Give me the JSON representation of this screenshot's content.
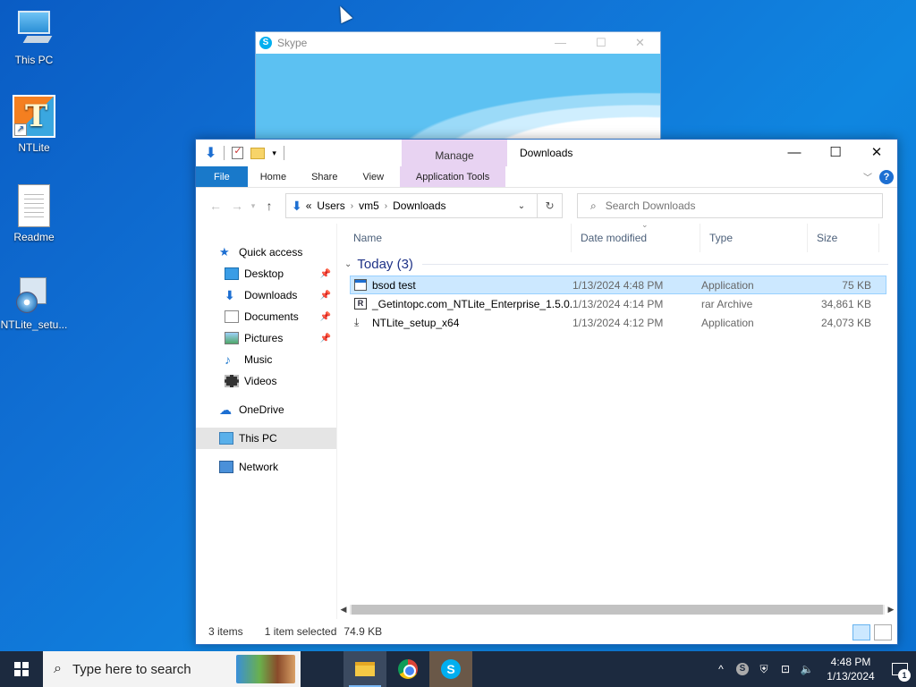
{
  "desktop": {
    "icons": [
      {
        "label": "This PC"
      },
      {
        "label": "NTLite"
      },
      {
        "label": "Readme"
      },
      {
        "label": "NTLite_setu..."
      }
    ]
  },
  "skype": {
    "title": "Skype",
    "logo_glyph": "S"
  },
  "explorer": {
    "manage_tab": "Manage",
    "title": "Downloads",
    "window_buttons": {
      "minimize": "—",
      "maximize": "☐",
      "close": "✕"
    },
    "ribbon_tabs": [
      "File",
      "Home",
      "Share",
      "View",
      "Application Tools"
    ],
    "help_glyph": "?",
    "address": {
      "prefix": "«",
      "crumbs": [
        "Users",
        "vm5",
        "Downloads"
      ]
    },
    "search": {
      "placeholder": "Search Downloads"
    },
    "nav": {
      "quick_access": "Quick access",
      "items": [
        {
          "label": "Desktop",
          "pinned": true
        },
        {
          "label": "Downloads",
          "pinned": true
        },
        {
          "label": "Documents",
          "pinned": true
        },
        {
          "label": "Pictures",
          "pinned": true
        },
        {
          "label": "Music",
          "pinned": false
        },
        {
          "label": "Videos",
          "pinned": false
        }
      ],
      "onedrive": "OneDrive",
      "this_pc": "This PC",
      "network": "Network"
    },
    "columns": [
      "Name",
      "Date modified",
      "Type",
      "Size"
    ],
    "group": {
      "label": "Today (3)"
    },
    "files": [
      {
        "name": "bsod test",
        "date": "1/13/2024 4:48 PM",
        "type": "Application",
        "size": "75 KB",
        "selected": true,
        "icon": "app-icon"
      },
      {
        "name": "_Getintopc.com_NTLite_Enterprise_1.5.0....",
        "date": "1/13/2024 4:14 PM",
        "type": "rar Archive",
        "size": "34,861 KB",
        "selected": false,
        "icon": "rar-icon"
      },
      {
        "name": "NTLite_setup_x64",
        "date": "1/13/2024 4:12 PM",
        "type": "Application",
        "size": "24,073 KB",
        "selected": false,
        "icon": "installer-icon"
      }
    ],
    "status": {
      "items": "3 items",
      "selected": "1 item selected",
      "size": "74.9 KB"
    }
  },
  "taskbar": {
    "search_placeholder": "Type here to search",
    "skype_glyph": "S",
    "tray_skype": "S",
    "clock_time": "4:48 PM",
    "clock_date": "1/13/2024",
    "notifications_count": "1"
  }
}
